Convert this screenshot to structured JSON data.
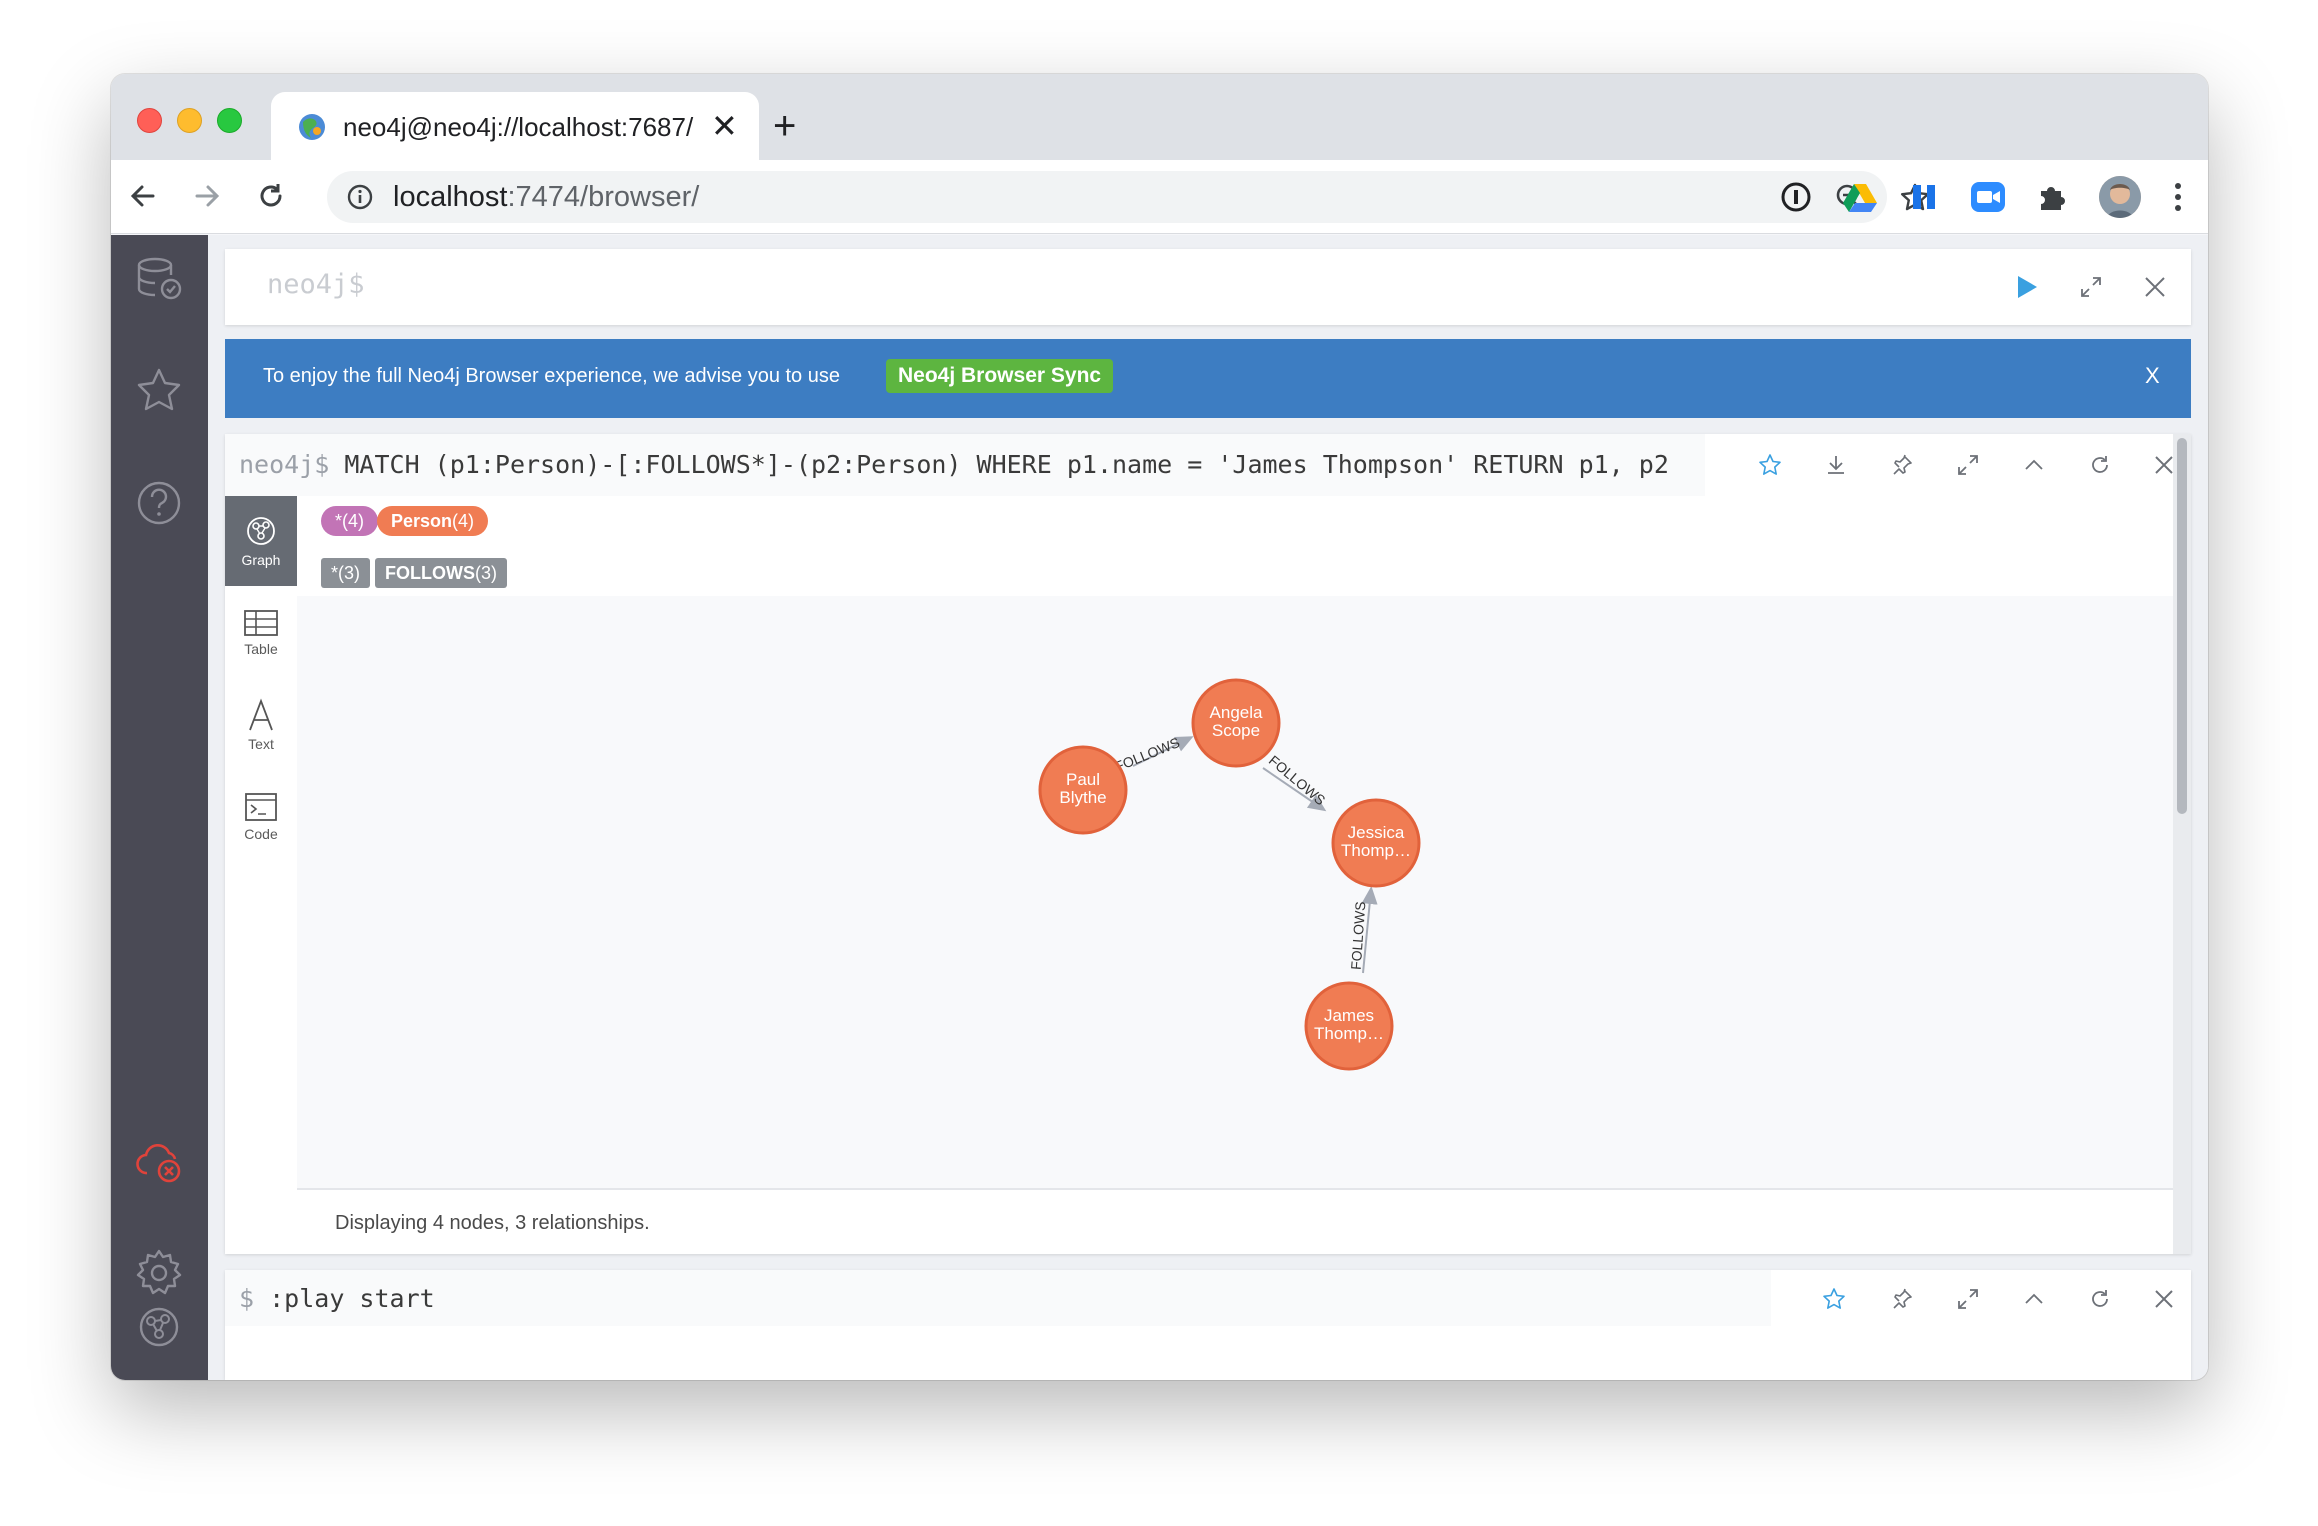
{
  "browser": {
    "tab_title": "neo4j@neo4j://localhost:7687/",
    "new_tab": "+",
    "close_tab": "✕",
    "url_host": "localhost",
    "url_path": ":7474/browser/"
  },
  "editor": {
    "placeholder": "neo4j$"
  },
  "banner": {
    "text": "To enjoy the full Neo4j Browser experience, we advise you to use",
    "link_label": "Neo4j Browser Sync",
    "close_label": "X"
  },
  "result_frame": {
    "prompt": "neo4j$",
    "query": "MATCH (p1:Person)-[:FOLLOWS*]-(p2:Person) WHERE p1.name = 'James Thompson' RETURN p1, p2",
    "view_tabs": [
      {
        "label": "Graph",
        "icon": "graph-icon"
      },
      {
        "label": "Table",
        "icon": "table-icon"
      },
      {
        "label": "Text",
        "icon": "text-icon"
      },
      {
        "label": "Code",
        "icon": "code-icon"
      }
    ],
    "legend": {
      "node_all": {
        "label": "*",
        "count": "(4)"
      },
      "node_person": {
        "label": "Person",
        "count": "(4)"
      },
      "rel_all": {
        "label": "*",
        "count": "(3)"
      },
      "rel_follows": {
        "label": "FOLLOWS",
        "count": "(3)"
      }
    },
    "footer": "Displaying 4 nodes, 3 relationships.",
    "graph": {
      "nodes": [
        {
          "id": "paul",
          "line1": "Paul",
          "line2": "Blythe"
        },
        {
          "id": "angela",
          "line1": "Angela",
          "line2": "Scope"
        },
        {
          "id": "jessica",
          "line1": "Jessica",
          "line2": "Thomp…"
        },
        {
          "id": "james",
          "line1": "James",
          "line2": "Thomp…"
        }
      ],
      "relationships": [
        {
          "from": "paul",
          "to": "angela",
          "type": "FOLLOWS"
        },
        {
          "from": "angela",
          "to": "jessica",
          "type": "FOLLOWS"
        },
        {
          "from": "james",
          "to": "jessica",
          "type": "FOLLOWS"
        }
      ]
    }
  },
  "second_frame": {
    "prompt": "$",
    "query": ":play start"
  },
  "colors": {
    "sidebar": "#4a4a55",
    "banner": "#3d7dc2",
    "banner_link": "#5db540",
    "node_fill": "#f07c53",
    "node_stroke": "#e1623b",
    "pill_all": "#c274b6",
    "pill_person": "#f07c53",
    "pill_rel": "#8b9096",
    "accent": "#3aa0e0"
  }
}
